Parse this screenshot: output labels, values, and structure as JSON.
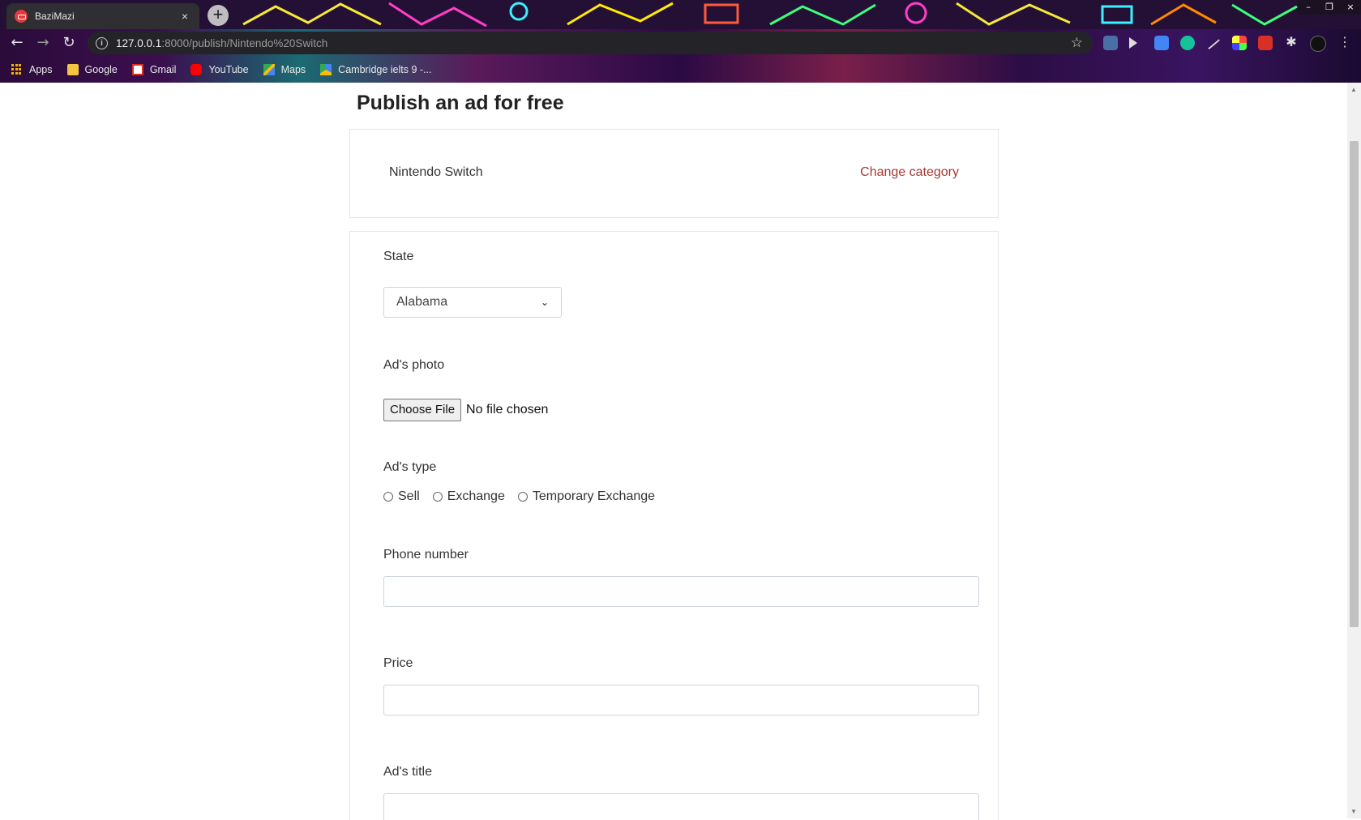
{
  "browser": {
    "tab_title": "BaziMazi",
    "tab_close": "×",
    "new_tab": "+",
    "window_controls": [
      "–",
      "❐",
      "×"
    ],
    "nav": {
      "back": "←",
      "forward": "→",
      "reload": "↻"
    },
    "url_host": "127.0.0.1",
    "url_path": ":8000/publish/Nintendo%20Switch",
    "star": "☆",
    "bookmarks": [
      {
        "label": "Apps",
        "icon": "apps-grid-icon"
      },
      {
        "label": "Google",
        "icon": "bookmark-folder-icon"
      },
      {
        "label": "Gmail",
        "icon": "gmail-icon"
      },
      {
        "label": "YouTube",
        "icon": "youtube-icon"
      },
      {
        "label": "Maps",
        "icon": "maps-icon"
      },
      {
        "label": "Cambridge ielts 9 -...",
        "icon": "drive-icon"
      }
    ],
    "menu": "⋮"
  },
  "page": {
    "heading": "Publish an ad for free",
    "category": {
      "name": "Nintendo Switch",
      "change_label": "Change category"
    },
    "form": {
      "state_label": "State",
      "state_value": "Alabama",
      "photo_label": "Ad's photo",
      "file_button": "Choose File",
      "file_status": "No file chosen",
      "type_label": "Ad's type",
      "type_options": [
        "Sell",
        "Exchange",
        "Temporary Exchange"
      ],
      "phone_label": "Phone number",
      "price_label": "Price",
      "title_label": "Ad's title"
    }
  },
  "colors": {
    "accent_link": "#a33a33",
    "heading": "#222222"
  }
}
